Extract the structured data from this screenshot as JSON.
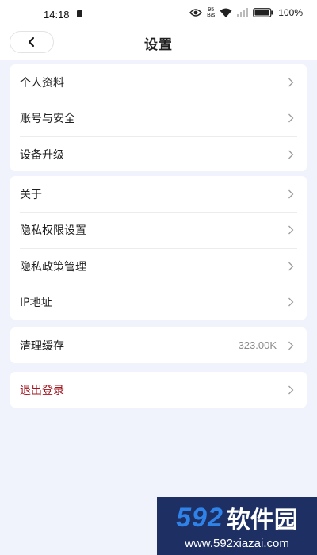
{
  "status_bar": {
    "time": "14:18",
    "net_speed_value": "95",
    "net_speed_unit": "B/s",
    "battery": "100%",
    "icons": [
      "lock-icon",
      "eye-icon",
      "wifi-icon",
      "signal-icon",
      "battery-icon"
    ]
  },
  "header": {
    "title": "设置",
    "back_icon": "chevron-left-icon"
  },
  "groups": [
    {
      "items": [
        {
          "label": "个人资料"
        },
        {
          "label": "账号与安全"
        },
        {
          "label": "设备升级"
        }
      ]
    },
    {
      "items": [
        {
          "label": "关于"
        },
        {
          "label": "隐私权限设置"
        },
        {
          "label": "隐私政策管理"
        },
        {
          "label": "IP地址"
        }
      ]
    },
    {
      "items": [
        {
          "label": "清理缓存",
          "value": "323.00K"
        }
      ]
    },
    {
      "items": [
        {
          "label": "退出登录"
        }
      ]
    }
  ],
  "watermark": {
    "brand_number": "592",
    "brand_text": "软件园",
    "url": "www.592xiazai.com"
  },
  "colors": {
    "page_background": "#f0f3fc",
    "card_background": "#ffffff",
    "logout_text": "#a3141e",
    "value_text": "#8a8a8a",
    "watermark_background": "#1d2f63",
    "watermark_accent": "#2f83e8"
  }
}
